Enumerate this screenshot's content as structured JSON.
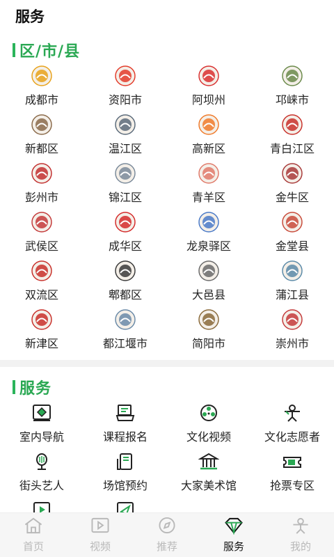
{
  "page": {
    "title": "服务"
  },
  "districts_section": {
    "title": "区/市/县",
    "items": [
      {
        "label": "成都市",
        "icon": "chengdu-logo",
        "color": "#e8a21a"
      },
      {
        "label": "资阳市",
        "icon": "ziyang-logo",
        "color": "#e33b2a"
      },
      {
        "label": "阿坝州",
        "icon": "aba-logo",
        "color": "#d93030"
      },
      {
        "label": "邛崃市",
        "icon": "qionglai-logo",
        "color": "#6a8a4a"
      },
      {
        "label": "新都区",
        "icon": "xindu-logo",
        "color": "#8a6a4a"
      },
      {
        "label": "温江区",
        "icon": "wenjiang-logo",
        "color": "#5a6a7a"
      },
      {
        "label": "高新区",
        "icon": "gaoxin-logo",
        "color": "#f07a2a"
      },
      {
        "label": "青白江区",
        "icon": "qingbaijiang-logo",
        "color": "#c8302a"
      },
      {
        "label": "彭州市",
        "icon": "pengzhou-logo",
        "color": "#c23030"
      },
      {
        "label": "锦江区",
        "icon": "jinjiang-logo",
        "color": "#7a8a9a"
      },
      {
        "label": "青羊区",
        "icon": "qingyang-logo",
        "color": "#e07a6a"
      },
      {
        "label": "金牛区",
        "icon": "jinniu-logo",
        "color": "#a83a3a"
      },
      {
        "label": "武侯区",
        "icon": "wuhou-logo",
        "color": "#c43a3a"
      },
      {
        "label": "成华区",
        "icon": "chenghua-logo",
        "color": "#d42a2a"
      },
      {
        "label": "龙泉驿区",
        "icon": "longquanyi-logo",
        "color": "#4a7ac8"
      },
      {
        "label": "金堂县",
        "icon": "jintang-logo",
        "color": "#c84a3a"
      },
      {
        "label": "双流区",
        "icon": "shuangliu-logo",
        "color": "#c8302a"
      },
      {
        "label": "郫都区",
        "icon": "pidu-logo",
        "color": "#3a3a3a"
      },
      {
        "label": "大邑县",
        "icon": "dayi-logo",
        "color": "#6a6a6a"
      },
      {
        "label": "蒲江县",
        "icon": "pujiang-logo",
        "color": "#5a8aa8"
      },
      {
        "label": "新津区",
        "icon": "xinjin-logo",
        "color": "#c8302a"
      },
      {
        "label": "都江堰市",
        "icon": "dujiangyan-logo",
        "color": "#6a8aa8"
      },
      {
        "label": "简阳市",
        "icon": "jianyang-logo",
        "color": "#8a6a3a"
      },
      {
        "label": "崇州市",
        "icon": "chongzhou-logo",
        "color": "#c43a3a"
      }
    ]
  },
  "services_section": {
    "title": "服务",
    "items": [
      {
        "label": "室内导航",
        "icon": "indoor-navigation-icon"
      },
      {
        "label": "课程报名",
        "icon": "course-signup-icon"
      },
      {
        "label": "文化视频",
        "icon": "culture-video-icon"
      },
      {
        "label": "文化志愿者",
        "icon": "volunteer-icon"
      },
      {
        "label": "街头艺人",
        "icon": "street-artist-icon"
      },
      {
        "label": "场馆预约",
        "icon": "venue-booking-icon"
      },
      {
        "label": "大家美术馆",
        "icon": "art-museum-icon"
      },
      {
        "label": "抢票专区",
        "icon": "ticket-icon"
      },
      {
        "label": "",
        "icon": "play-icon"
      },
      {
        "label": "",
        "icon": "send-icon"
      }
    ]
  },
  "tabbar": {
    "tabs": [
      {
        "label": "首页",
        "icon": "home-icon",
        "active": false
      },
      {
        "label": "视频",
        "icon": "video-icon",
        "active": false
      },
      {
        "label": "推荐",
        "icon": "compass-icon",
        "active": false
      },
      {
        "label": "服务",
        "icon": "diamond-icon",
        "active": true
      },
      {
        "label": "我的",
        "icon": "profile-icon",
        "active": false
      }
    ]
  },
  "colors": {
    "accent": "#2aa853",
    "active_tab": "#111111",
    "inactive_tab": "#b9b9b9"
  }
}
